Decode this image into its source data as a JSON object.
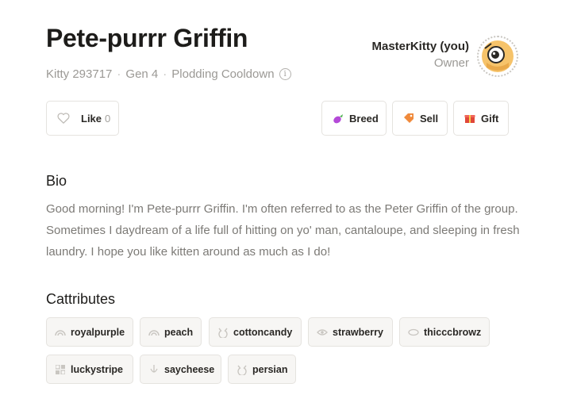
{
  "kitty": {
    "name": "Pete-purrr Griffin",
    "id_label": "Kitty 293717",
    "generation": "Gen 4",
    "cooldown": "Plodding Cooldown"
  },
  "owner": {
    "name": "MasterKitty (you)",
    "role": "Owner"
  },
  "actions": {
    "like_label": "Like",
    "like_count": "0",
    "breed_label": "Breed",
    "sell_label": "Sell",
    "gift_label": "Gift"
  },
  "bio": {
    "heading": "Bio",
    "text": "Good morning! I'm Pete-purrr Griffin. I'm often referred to as the Peter Griffin of the group. Sometimes I daydream of a life full of hitting on yo' man, cantaloupe, and sleeping in fresh laundry. I hope you like kitten around as much as I do!"
  },
  "cattributes": {
    "heading": "Cattributes",
    "items": [
      {
        "label": "royalpurple",
        "icon": "rainbow-icon"
      },
      {
        "label": "peach",
        "icon": "rainbow-icon"
      },
      {
        "label": "cottoncandy",
        "icon": "cat-head-icon"
      },
      {
        "label": "strawberry",
        "icon": "eye-icon"
      },
      {
        "label": "thicccbrowz",
        "icon": "eye-icon"
      },
      {
        "label": "luckystripe",
        "icon": "pattern-icon"
      },
      {
        "label": "saycheese",
        "icon": "mouth-icon"
      },
      {
        "label": "persian",
        "icon": "cat-head-icon"
      }
    ]
  },
  "colors": {
    "border": "#e5e3df",
    "muted_text": "#9b9995",
    "tag_bg": "#f7f6f4"
  }
}
